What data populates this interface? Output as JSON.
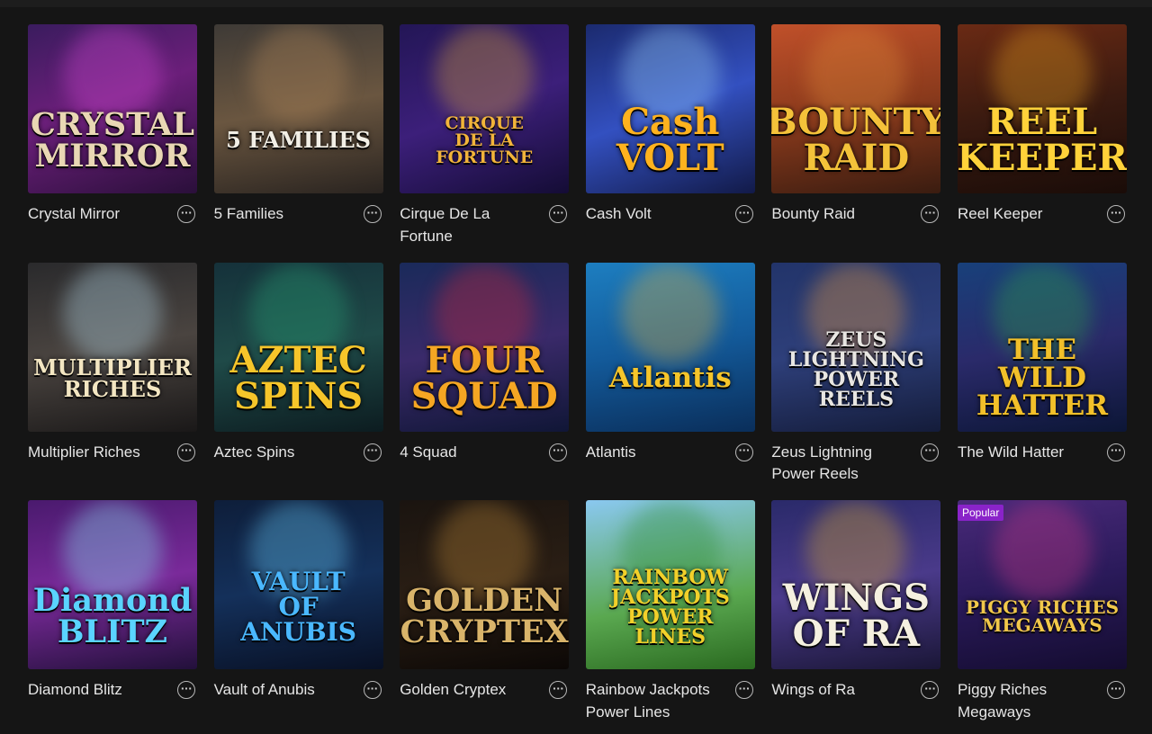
{
  "games": [
    {
      "title": "Crystal Mirror",
      "logo": "CRYSTAL\nMIRROR",
      "bg": "linear-gradient(160deg,#3a1c5e 0%,#6b1f7a 45%,#2a0f3a 100%)",
      "logo_color": "#e9d7b4",
      "accent": "#d84bd8"
    },
    {
      "title": "5 Families",
      "logo": "5 FAMILIES",
      "bg": "linear-gradient(170deg,#3e3a36 0%,#6a5640 50%,#2a2420 100%)",
      "logo_color": "#f2efe6",
      "accent": "#b58a5c"
    },
    {
      "title": "Cirque De La Fortune",
      "logo": "CIRQUE\nDE LA FORTUNE",
      "bg": "linear-gradient(160deg,#231656 0%,#3c1f7a 50%,#140c35 100%)",
      "logo_color": "#f2b43a",
      "accent": "#e0a93a"
    },
    {
      "title": "Cash Volt",
      "logo": "Cash\nVOLT",
      "bg": "linear-gradient(160deg,#1b2a6e 0%,#3350c0 50%,#121a48 100%)",
      "logo_color": "#ffb21e",
      "accent": "#9fd8ff"
    },
    {
      "title": "Bounty Raid",
      "logo": "BOUNTY\nRAID",
      "bg": "linear-gradient(170deg,#c0502a 0%,#8a3a1c 50%,#3a1c10 100%)",
      "logo_color": "#f4c23a",
      "accent": "#e08a3a"
    },
    {
      "title": "Reel Keeper",
      "logo": "REEL\nKEEPER",
      "bg": "linear-gradient(170deg,#6a2a14 0%,#3a1a10 50%,#1a0c08 100%)",
      "logo_color": "#ffd23a",
      "accent": "#e8a020"
    },
    {
      "title": "Multiplier Riches",
      "logo": "MULTIPLIER\nRICHES",
      "bg": "linear-gradient(170deg,#2a2a2c 0%,#4a4440 50%,#1a1818 100%)",
      "logo_color": "#f3e6c2",
      "accent": "#bfe4f5"
    },
    {
      "title": "Aztec Spins",
      "logo": "AZTEC\nSPINS",
      "bg": "linear-gradient(170deg,#15313a 0%,#1f4a48 50%,#0c1c20 100%)",
      "logo_color": "#f6c52a",
      "accent": "#2aa87a"
    },
    {
      "title": "4 Squad",
      "logo": "FOUR\nSQUAD",
      "bg": "linear-gradient(170deg,#1a2a5a 0%,#3a2a6a 50%,#101636 100%)",
      "logo_color": "#f5a623",
      "accent": "#d02a3a"
    },
    {
      "title": "Atlantis",
      "logo": "Atlantis",
      "bg": "linear-gradient(170deg,#1d7ec0 0%,#135a9a 50%,#0a2e5a 100%)",
      "logo_color": "#f6c52a",
      "accent": "#e6b43a"
    },
    {
      "title": "Zeus Lightning Power Reels",
      "logo": "ZEUS\nLIGHTNING\nPOWER REELS",
      "bg": "linear-gradient(170deg,#22346a 0%,#2e3f7a 50%,#141c3a 100%)",
      "logo_color": "#e8e6e2",
      "accent": "#f0a040"
    },
    {
      "title": "The Wild Hatter",
      "logo": "THE WILD\nHATTER",
      "bg": "linear-gradient(170deg,#18407a 0%,#2a2a6a 50%,#0c1636 100%)",
      "logo_color": "#f2c02a",
      "accent": "#2fa84a"
    },
    {
      "title": "Diamond Blitz",
      "logo": "Diamond\nBLITZ",
      "bg": "linear-gradient(170deg,#4a1a6e 0%,#7a2a9a 50%,#22103a 100%)",
      "logo_color": "#5ad4ff",
      "accent": "#8ef0ff"
    },
    {
      "title": "Vault of Anubis",
      "logo": "VAULT\nOF\nANUBIS",
      "bg": "linear-gradient(170deg,#0e1e3a 0%,#14305a 50%,#081024 100%)",
      "logo_color": "#4ab8ff",
      "accent": "#6ad0ff"
    },
    {
      "title": "Golden Cryptex",
      "logo": "GOLDEN\nCRYPTEX",
      "bg": "linear-gradient(170deg,#1a1410 0%,#2a1e14 50%,#0c0806 100%)",
      "logo_color": "#d9b46a",
      "accent": "#c08a3a"
    },
    {
      "title": "Rainbow Jackpots Power Lines",
      "logo": "RAINBOW\nJACKPOTS\nPOWER LINES",
      "bg": "linear-gradient(170deg,#8ac8f0 0%,#5aa850 60%,#2a6a20 100%)",
      "logo_color": "#f2d02a",
      "accent": "#2a8a2a"
    },
    {
      "title": "Wings of Ra",
      "logo": "WINGS\nOF RA",
      "bg": "linear-gradient(170deg,#2a2a6a 0%,#4a3a8a 50%,#1a1636 100%)",
      "logo_color": "#f5f0e0",
      "accent": "#e0b030"
    },
    {
      "title": "Piggy Riches Megaways",
      "logo": "PIGGY RICHES\nMEGAWAYS",
      "bg": "linear-gradient(170deg,#4a2a7a 0%,#2a1a5a 50%,#140c30 100%)",
      "logo_color": "#f2c84a",
      "accent": "#d03a8a",
      "badge": "Popular"
    }
  ],
  "more_icon": "ellipsis-icon",
  "more_glyph": "···"
}
